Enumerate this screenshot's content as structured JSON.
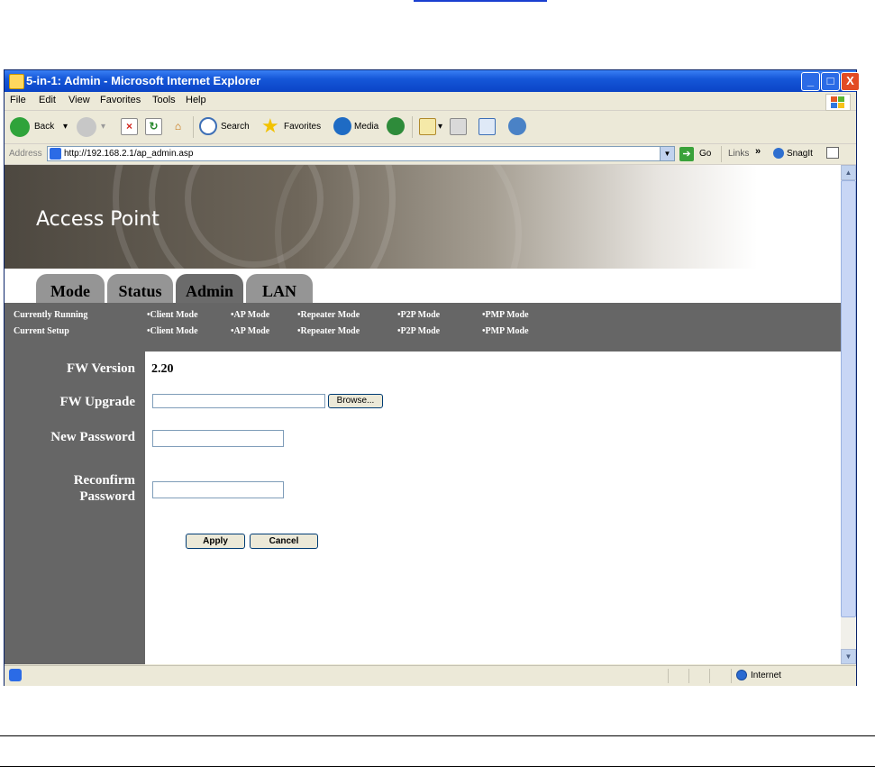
{
  "window": {
    "title": "5-in-1: Admin - Microsoft Internet Explorer",
    "controls": [
      "_",
      "□",
      "X"
    ]
  },
  "menu": [
    "File",
    "Edit",
    "View",
    "Favorites",
    "Tools",
    "Help"
  ],
  "toolbar": {
    "back": "Back",
    "search": "Search",
    "favorites": "Favorites",
    "media": "Media"
  },
  "address": {
    "label": "Address",
    "url": "http://192.168.2.1/ap_admin.asp",
    "go": "Go",
    "links": "Links",
    "chevron": "»",
    "snagit": "SnagIt"
  },
  "page": {
    "banner_title": "Access Point",
    "tabs": [
      "Mode",
      "Status",
      "Admin",
      "LAN"
    ],
    "active_tab": "Admin",
    "rows": [
      {
        "label": "Currently Running",
        "modes": [
          "•Client Mode",
          "•AP Mode",
          "•Repeater Mode",
          "•P2P Mode",
          "•PMP Mode"
        ]
      },
      {
        "label": "Current Setup",
        "modes": [
          "•Client Mode",
          "•AP Mode",
          "•Repeater Mode",
          "•P2P Mode",
          "•PMP Mode"
        ]
      }
    ],
    "fields": {
      "fw_version_label": "FW Version",
      "fw_version_value": "2.20",
      "fw_upgrade_label": "FW Upgrade",
      "browse": "Browse...",
      "new_password_label": "New Password",
      "reconfirm_label_1": "Reconfirm",
      "reconfirm_label_2": "Password"
    },
    "buttons": {
      "apply": "Apply",
      "cancel": "Cancel"
    }
  },
  "status": {
    "zone": "Internet"
  },
  "colors": {
    "panel_gray": "#666666",
    "tab_gray": "#959595",
    "xp_blue": "#0b44c6"
  }
}
